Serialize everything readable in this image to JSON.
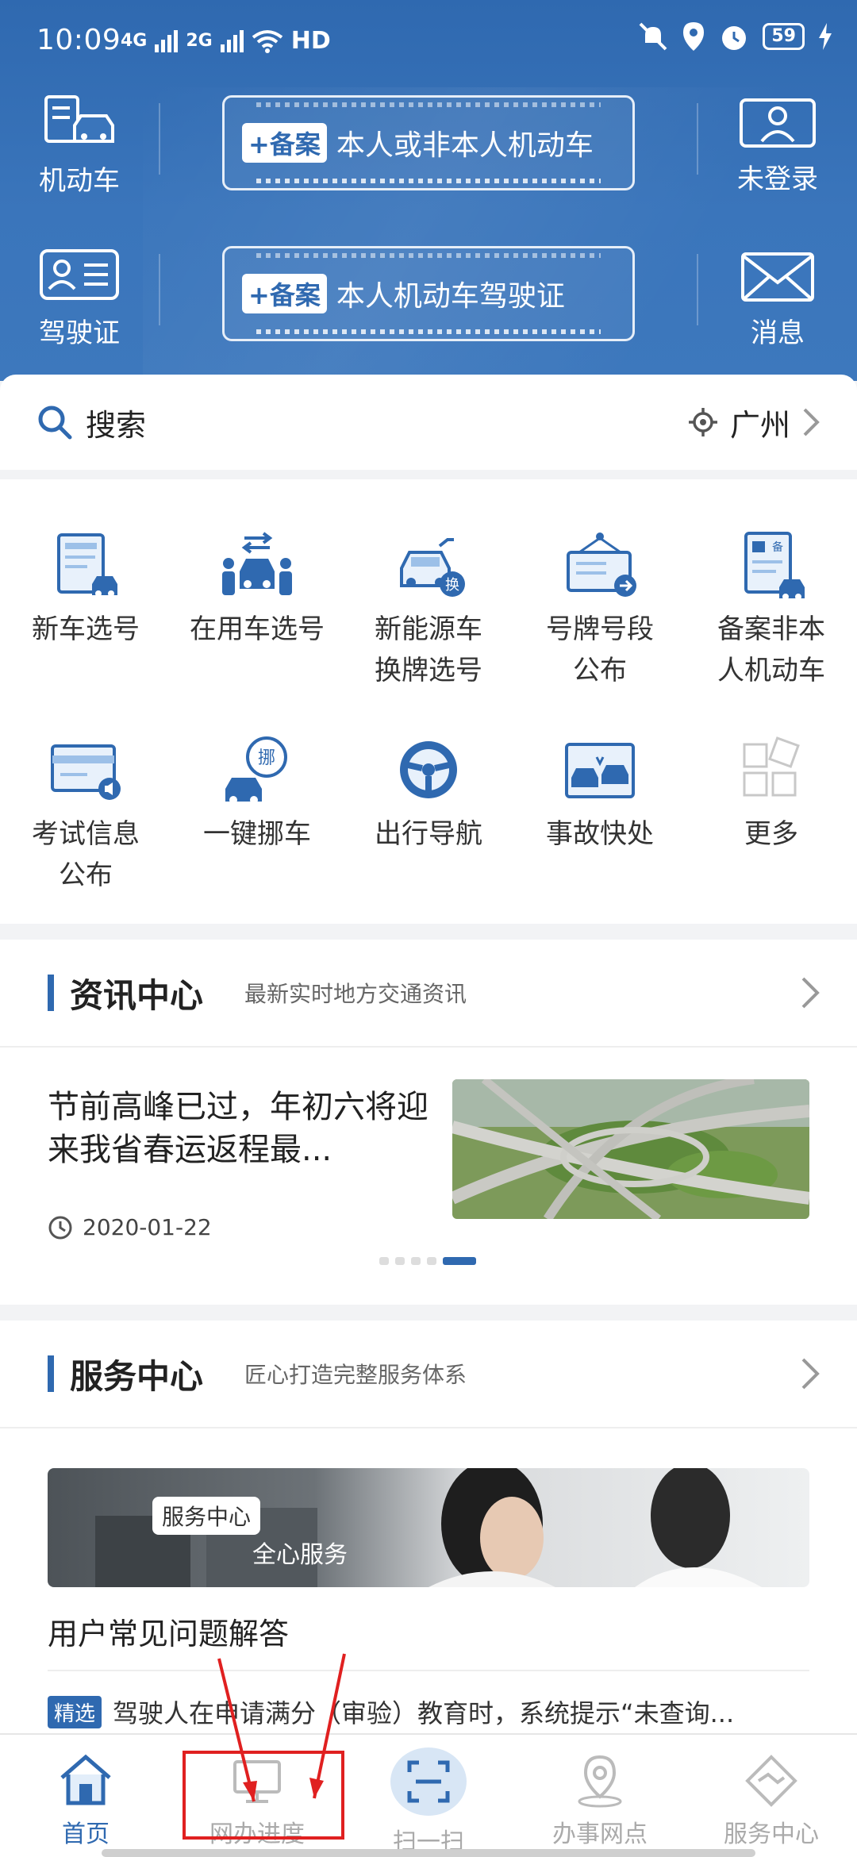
{
  "status_bar": {
    "time": "10:09",
    "net1": "4G",
    "net2": "2G",
    "wifi_text": "HD",
    "battery": "59"
  },
  "header": {
    "left_top": {
      "label": "机动车",
      "icon": "vehicle-list-icon"
    },
    "left_bottom": {
      "label": "驾驶证",
      "icon": "license-card-icon"
    },
    "right_top": {
      "label": "未登录",
      "icon": "user-icon"
    },
    "right_bottom": {
      "label": "消息",
      "icon": "mail-icon"
    },
    "card1": {
      "tag": "+备案",
      "text": "本人或非本人机动车"
    },
    "card2": {
      "tag": "+备案",
      "text": "本人机动车驾驶证"
    }
  },
  "search": {
    "label": "搜索",
    "city": "广州"
  },
  "services": [
    {
      "line1": "新车选号",
      "line2": "",
      "icon": "new-car-plate-icon"
    },
    {
      "line1": "在用车选号",
      "line2": "",
      "icon": "used-car-swap-icon"
    },
    {
      "line1": "新能源车",
      "line2": "换牌选号",
      "icon": "ev-plate-icon"
    },
    {
      "line1": "号牌号段",
      "line2": "公布",
      "icon": "plate-range-icon"
    },
    {
      "line1": "备案非本",
      "line2": "人机动车",
      "icon": "register-vehicle-icon"
    },
    {
      "line1": "考试信息",
      "line2": "公布",
      "icon": "exam-info-icon"
    },
    {
      "line1": "一键挪车",
      "line2": "",
      "icon": "move-car-icon"
    },
    {
      "line1": "出行导航",
      "line2": "",
      "icon": "steering-wheel-icon"
    },
    {
      "line1": "事故快处",
      "line2": "",
      "icon": "accident-icon"
    },
    {
      "line1": "更多",
      "line2": "",
      "icon": "more-grid-icon"
    }
  ],
  "news": {
    "title": "资讯中心",
    "subtitle": "最新实时地方交通资讯",
    "headline": "节前高峰已过，年初六将迎来我省春运返程最...",
    "date": "2020-01-22"
  },
  "service_center": {
    "title": "服务中心",
    "subtitle": "匠心打造完整服务体系",
    "banner_tag": "服务中心",
    "banner_slogan": "全心服务",
    "faq_title": "用户常见问题解答",
    "faq_badge": "精选",
    "faq_text": "驾驶人在申请满分（审验）教育时，系统提示“未查询..."
  },
  "bottom_nav": [
    {
      "label": "首页",
      "icon": "home-icon",
      "active": true
    },
    {
      "label": "网办进度",
      "icon": "monitor-icon",
      "active": false
    },
    {
      "label": "扫一扫",
      "icon": "scan-icon",
      "active": false
    },
    {
      "label": "办事网点",
      "icon": "location-pin-icon",
      "active": false
    },
    {
      "label": "服务中心",
      "icon": "handshake-icon",
      "active": false
    }
  ],
  "colors": {
    "brand": "#2f69b0",
    "annotation": "#e02020"
  }
}
